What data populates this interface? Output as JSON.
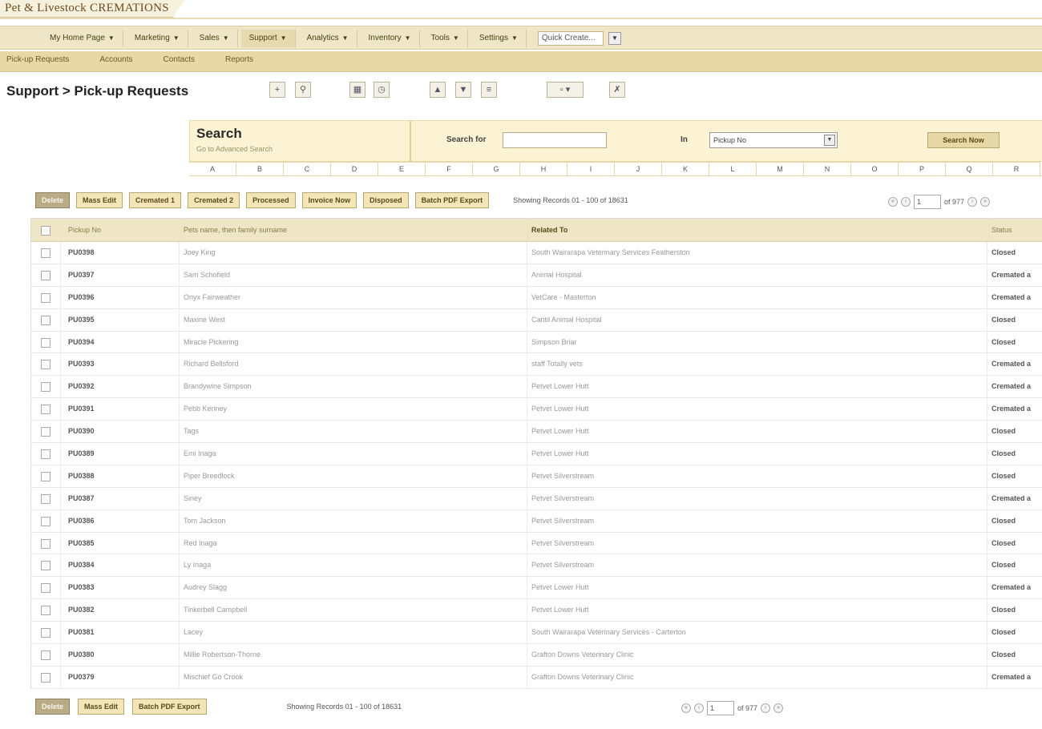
{
  "brand": {
    "name": "Pet & Livestock CREMATIONS"
  },
  "main_nav": {
    "items": [
      {
        "label": "My Home Page",
        "active": false
      },
      {
        "label": "Marketing",
        "active": false
      },
      {
        "label": "Sales",
        "active": false
      },
      {
        "label": "Support",
        "active": true
      },
      {
        "label": "Analytics",
        "active": false
      },
      {
        "label": "Inventory",
        "active": false
      },
      {
        "label": "Tools",
        "active": false
      },
      {
        "label": "Settings",
        "active": false
      }
    ],
    "quick_create": "Quick Create..."
  },
  "sub_nav": {
    "items": [
      "Pick-up Requests",
      "Accounts",
      "Contacts",
      "Reports"
    ]
  },
  "page_title": "Support > Pick-up Requests",
  "search": {
    "title": "Search",
    "advanced_link": "Go to Advanced Search",
    "search_for_label": "Search for",
    "search_for_value": "",
    "in_label": "In",
    "in_value": "Pickup No",
    "search_button": "Search Now",
    "alphabet": [
      "A",
      "B",
      "C",
      "D",
      "E",
      "F",
      "G",
      "H",
      "I",
      "J",
      "K",
      "L",
      "M",
      "N",
      "O",
      "P",
      "Q",
      "R"
    ]
  },
  "actions": {
    "top": [
      "Delete",
      "Mass Edit",
      "Cremated 1",
      "Cremated 2",
      "Processed",
      "Invoice Now",
      "Disposed",
      "Batch PDF Export"
    ],
    "bottom": [
      "Delete",
      "Mass Edit",
      "Batch PDF Export"
    ],
    "records_top": "Showing Records 01 - 100 of 18631",
    "records_bottom": "Showing Records 01 - 100 of 18631",
    "page_value": "1",
    "page_total": "of 977"
  },
  "table": {
    "columns": [
      "Pickup No",
      "Pets name, then family surname",
      "Related To",
      "Status"
    ],
    "rows": [
      {
        "pickup": "PU0398",
        "pet": "Joey King",
        "related": "South Wairarapa Veterinary Services Featherston",
        "status": "Closed"
      },
      {
        "pickup": "PU0397",
        "pet": "Sam Schofield",
        "related": "Animal Hospital",
        "status": "Cremated a"
      },
      {
        "pickup": "PU0396",
        "pet": "Onyx Fairweather",
        "related": "VetCare - Masterton",
        "status": "Cremated a"
      },
      {
        "pickup": "PU0395",
        "pet": "Maxine West",
        "related": "Cantil Animal Hospital",
        "status": "Closed"
      },
      {
        "pickup": "PU0394",
        "pet": "Miracle Pickering",
        "related": "Simpson Briar",
        "status": "Closed"
      },
      {
        "pickup": "PU0393",
        "pet": "Richard Bellsford",
        "related": "staff Totally vets",
        "status": "Cremated a"
      },
      {
        "pickup": "PU0392",
        "pet": "Brandywine Simpson",
        "related": "Petvet Lower Hutt",
        "status": "Cremated a"
      },
      {
        "pickup": "PU0391",
        "pet": "Pebb Kenney",
        "related": "Petvet Lower Hutt",
        "status": "Cremated a"
      },
      {
        "pickup": "PU0390",
        "pet": "Tags",
        "related": "Petvet Lower Hutt",
        "status": "Closed"
      },
      {
        "pickup": "PU0389",
        "pet": "Emi Inaga",
        "related": "Petvet Lower Hutt",
        "status": "Closed"
      },
      {
        "pickup": "PU0388",
        "pet": "Piper Breedlock",
        "related": "Petvet Silverstream",
        "status": "Closed"
      },
      {
        "pickup": "PU0387",
        "pet": "Siney",
        "related": "Petvet Silverstream",
        "status": "Cremated a"
      },
      {
        "pickup": "PU0386",
        "pet": "Tom Jackson",
        "related": "Petvet Silverstream",
        "status": "Closed"
      },
      {
        "pickup": "PU0385",
        "pet": "Red Inaga",
        "related": "Petvet Silverstream",
        "status": "Closed"
      },
      {
        "pickup": "PU0384",
        "pet": "Ly Inaga",
        "related": "Petvet Silverstream",
        "status": "Closed"
      },
      {
        "pickup": "PU0383",
        "pet": "Audrey Slagg",
        "related": "Petvet Lower Hutt",
        "status": "Cremated a"
      },
      {
        "pickup": "PU0382",
        "pet": "Tinkerbell Campbell",
        "related": "Petvet Lower Hutt",
        "status": "Closed"
      },
      {
        "pickup": "PU0381",
        "pet": "Lacey",
        "related": "South Wairarapa Veterinary Services - Carterton",
        "status": "Closed"
      },
      {
        "pickup": "PU0380",
        "pet": "Millie Robertson-Thorne",
        "related": "Grafton Downs Veterinary Clinic",
        "status": "Closed"
      },
      {
        "pickup": "PU0379",
        "pet": "Mischief Go Crook",
        "related": "Grafton Downs Veterinary Clinic",
        "status": "Cremated a"
      }
    ]
  }
}
